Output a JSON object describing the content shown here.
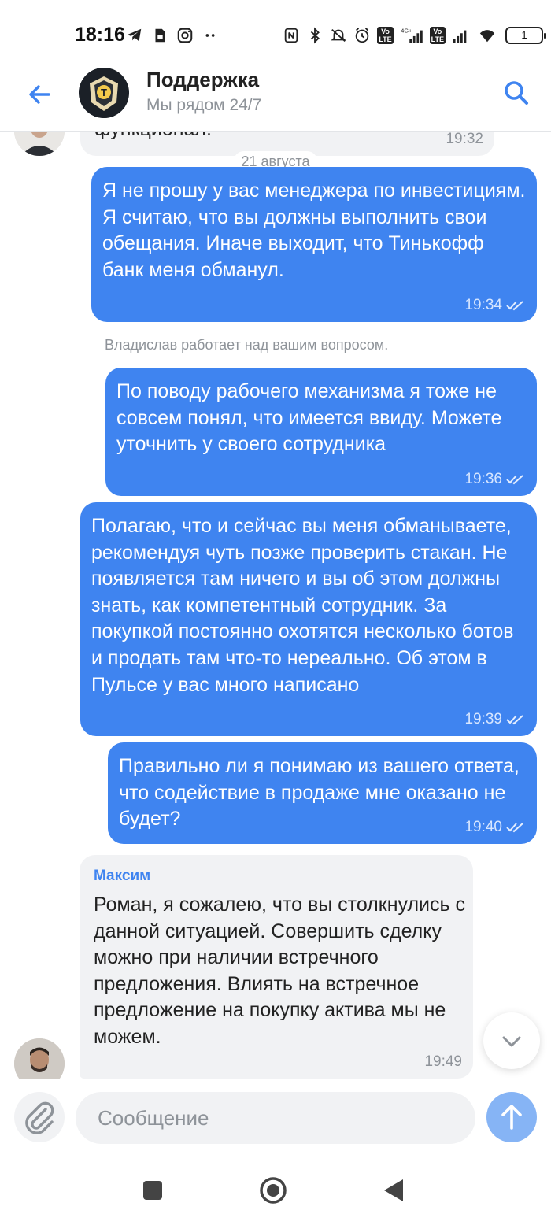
{
  "status_bar": {
    "time": "18:16",
    "battery": "1"
  },
  "header": {
    "title": "Поддержка",
    "subtitle": "Мы рядом 24/7"
  },
  "chat": {
    "prev_message_text": "функционал.",
    "prev_message_time": "19:32",
    "date_separator": "21 августа",
    "messages": [
      {
        "text": "Я не прошу у вас менеджера по инвестициям. Я считаю, что вы должны выполнить свои обещания. Иначе выходит, что Тинькофф банк меня обманул.",
        "time": "19:34"
      },
      {
        "text": "По поводу рабочего механизма я тоже не совсем понял, что имеется ввиду. Можете уточнить у своего сотрудника",
        "time": "19:36"
      },
      {
        "text": "Полагаю, что и сейчас вы меня обманываете, рекомендуя чуть позже проверить стакан. Не появляется там ничего и вы об этом должны знать, как компетентный сотрудник. За покупкой постоянно охотятся несколько ботов и продать там что-то нереально. Об этом в Пульсе у вас много написано",
        "time": "19:39"
      },
      {
        "text": "Правильно ли я понимаю из вашего ответа, что содействие в продаже мне оказано не будет?",
        "time": "19:40"
      }
    ],
    "system_note": "Владислав работает над вашим вопросом.",
    "reply": {
      "sender": "Максим",
      "text": "Роман, я сожалею, что вы столкнулись с данной ситуацией. Совершить сделку можно при наличии встречного предложения. Влиять на встречное предложение на покупку актива мы не можем.",
      "time": "19:49"
    }
  },
  "composer": {
    "placeholder": "Сообщение"
  },
  "colors": {
    "accent": "#3f84f0",
    "incoming_bubble": "#f1f2f4",
    "send_button": "#86b4f5"
  },
  "icons": {
    "back": "arrow-left-icon",
    "search": "search-icon",
    "attach": "paperclip-icon",
    "send": "arrow-up-icon",
    "scroll": "chevron-down-icon",
    "read": "double-check-icon"
  }
}
